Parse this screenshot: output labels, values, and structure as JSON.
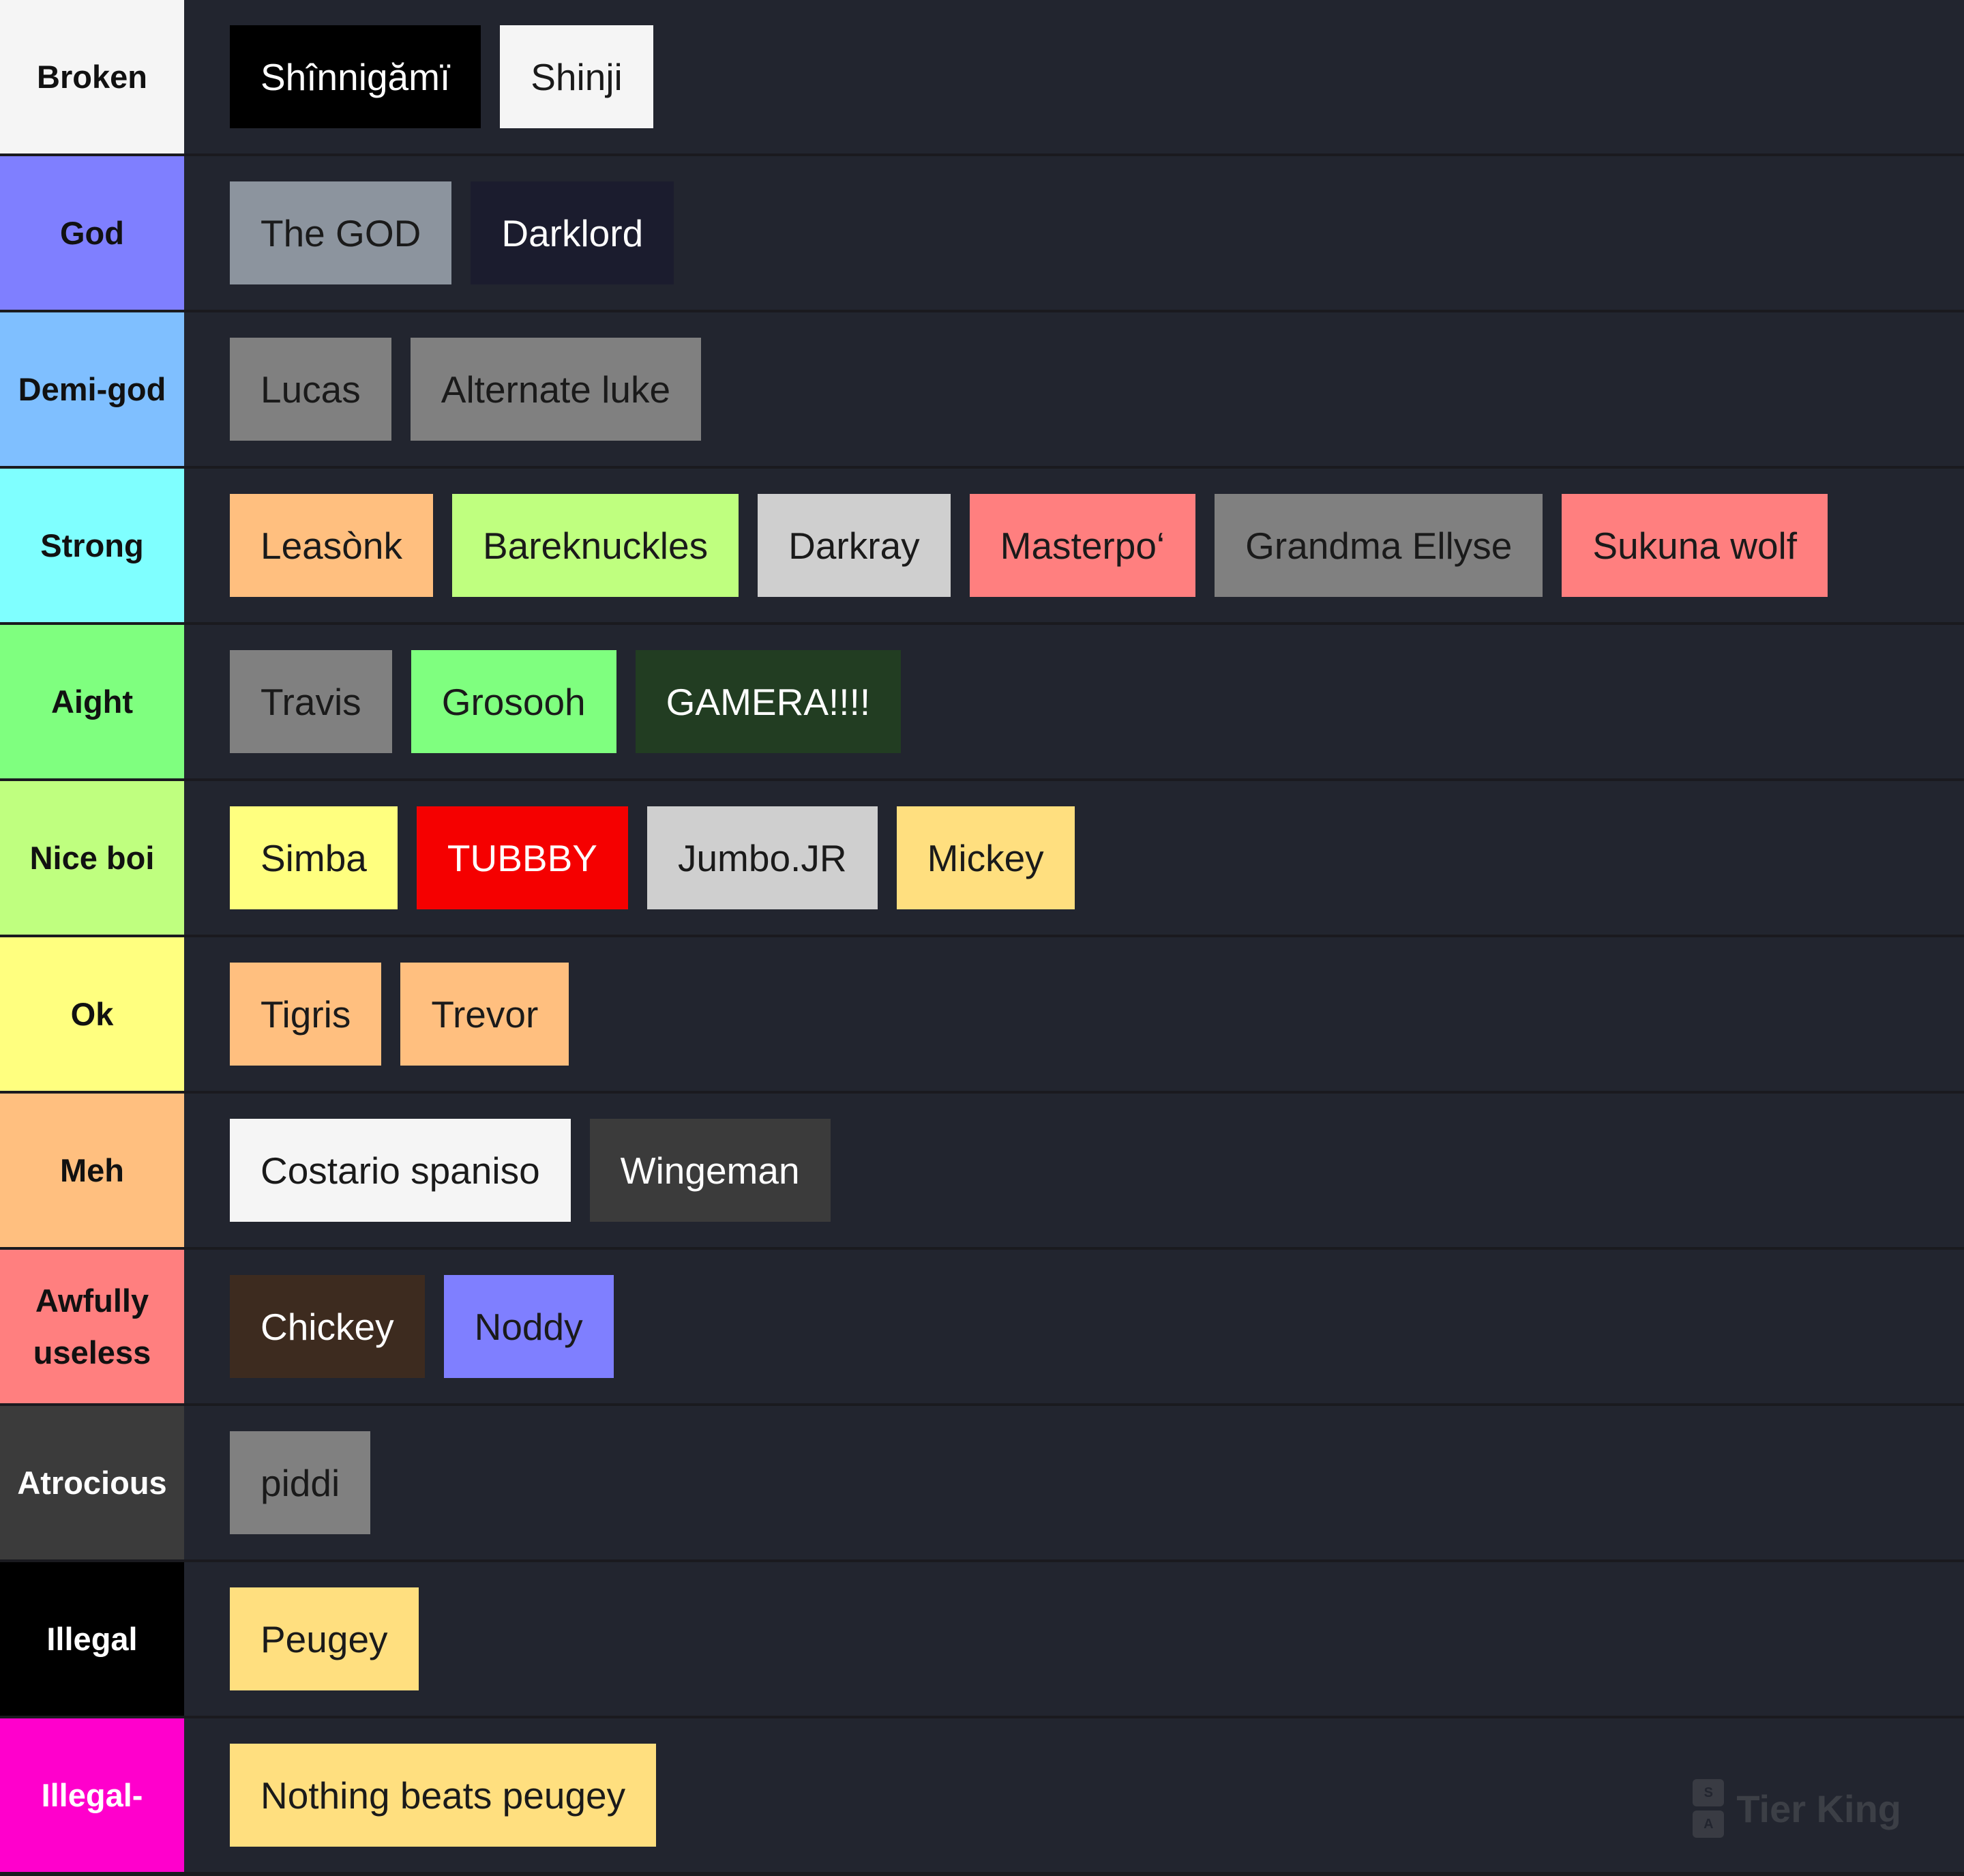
{
  "tiers": [
    {
      "label": "Broken",
      "label_bg": "#f5f5f5",
      "label_color": "#111111",
      "items": [
        {
          "name": "Shînnigămï",
          "bg": "#000000",
          "color": "#ffffff"
        },
        {
          "name": "Shinji",
          "bg": "#f5f5f5",
          "color": "#1a1a1a"
        }
      ]
    },
    {
      "label": "God",
      "label_bg": "#7f7fff",
      "label_color": "#111111",
      "items": [
        {
          "name": "The GOD",
          "bg": "#8c949e",
          "color": "#1a1a1a"
        },
        {
          "name": "Darklord",
          "bg": "#1b1c2e",
          "color": "#ffffff"
        }
      ]
    },
    {
      "label": "Demi-god",
      "label_bg": "#7fbfff",
      "label_color": "#111111",
      "items": [
        {
          "name": "Lucas",
          "bg": "#808080",
          "color": "#1a1a1a"
        },
        {
          "name": "Alternate luke",
          "bg": "#808080",
          "color": "#1a1a1a"
        }
      ]
    },
    {
      "label": "Strong",
      "label_bg": "#7fffff",
      "label_color": "#111111",
      "items": [
        {
          "name": "Leasònk",
          "bg": "#ffbf7f",
          "color": "#1a1a1a"
        },
        {
          "name": "Bareknuckles",
          "bg": "#bfff7f",
          "color": "#1a1a1a"
        },
        {
          "name": "Darkray",
          "bg": "#cfcfcf",
          "color": "#1a1a1a"
        },
        {
          "name": "Masterpo‘",
          "bg": "#ff7f7f",
          "color": "#1a1a1a"
        },
        {
          "name": "Grandma Ellyse",
          "bg": "#808080",
          "color": "#1a1a1a"
        },
        {
          "name": "Sukuna wolf",
          "bg": "#ff7f7f",
          "color": "#1a1a1a"
        }
      ]
    },
    {
      "label": "Aight",
      "label_bg": "#7fff7f",
      "label_color": "#111111",
      "items": [
        {
          "name": "Travis",
          "bg": "#808080",
          "color": "#1a1a1a"
        },
        {
          "name": "Grosooh",
          "bg": "#7fff7f",
          "color": "#1a1a1a"
        },
        {
          "name": "GAMERA!!!!",
          "bg": "#223d22",
          "color": "#ffffff"
        }
      ]
    },
    {
      "label": "Nice boi",
      "label_bg": "#bfff7f",
      "label_color": "#111111",
      "items": [
        {
          "name": "Simba",
          "bg": "#ffff7f",
          "color": "#1a1a1a"
        },
        {
          "name": "TUBBBY",
          "bg": "#f50000",
          "color": "#ffffff"
        },
        {
          "name": "Jumbo.JR",
          "bg": "#cfcfcf",
          "color": "#1a1a1a"
        },
        {
          "name": "Mickey",
          "bg": "#ffdf7f",
          "color": "#1a1a1a"
        }
      ]
    },
    {
      "label": "Ok",
      "label_bg": "#ffff7f",
      "label_color": "#111111",
      "items": [
        {
          "name": "Tigris",
          "bg": "#ffbf7f",
          "color": "#1a1a1a"
        },
        {
          "name": "Trevor",
          "bg": "#ffbf7f",
          "color": "#1a1a1a"
        }
      ]
    },
    {
      "label": "Meh",
      "label_bg": "#ffbf7f",
      "label_color": "#111111",
      "items": [
        {
          "name": "Costario spaniso",
          "bg": "#f5f5f5",
          "color": "#1a1a1a"
        },
        {
          "name": "Wingeman",
          "bg": "#3b3b3b",
          "color": "#ffffff"
        }
      ]
    },
    {
      "label": "Awfully useless",
      "label_bg": "#ff7f7f",
      "label_color": "#111111",
      "items": [
        {
          "name": "Chickey",
          "bg": "#3d2b1f",
          "color": "#ffffff"
        },
        {
          "name": "Noddy",
          "bg": "#7f7fff",
          "color": "#1a1a1a"
        }
      ]
    },
    {
      "label": "Atrocious",
      "label_bg": "#3b3b3b",
      "label_color": "#ffffff",
      "items": [
        {
          "name": "piddi",
          "bg": "#808080",
          "color": "#1a1a1a"
        }
      ]
    },
    {
      "label": "Illegal",
      "label_bg": "#000000",
      "label_color": "#ffffff",
      "items": [
        {
          "name": "Peugey",
          "bg": "#ffdf7f",
          "color": "#1a1a1a"
        }
      ]
    },
    {
      "label": "Illegal-",
      "label_bg": "#ff00cc",
      "label_color": "#ffffff",
      "items": [
        {
          "name": "Nothing beats peugey",
          "bg": "#ffdf7f",
          "color": "#1a1a1a"
        }
      ]
    }
  ],
  "watermark": {
    "text": "Tier King",
    "logo_letters": [
      "S",
      "A"
    ],
    "icon": "tier-king-logo-icon"
  }
}
